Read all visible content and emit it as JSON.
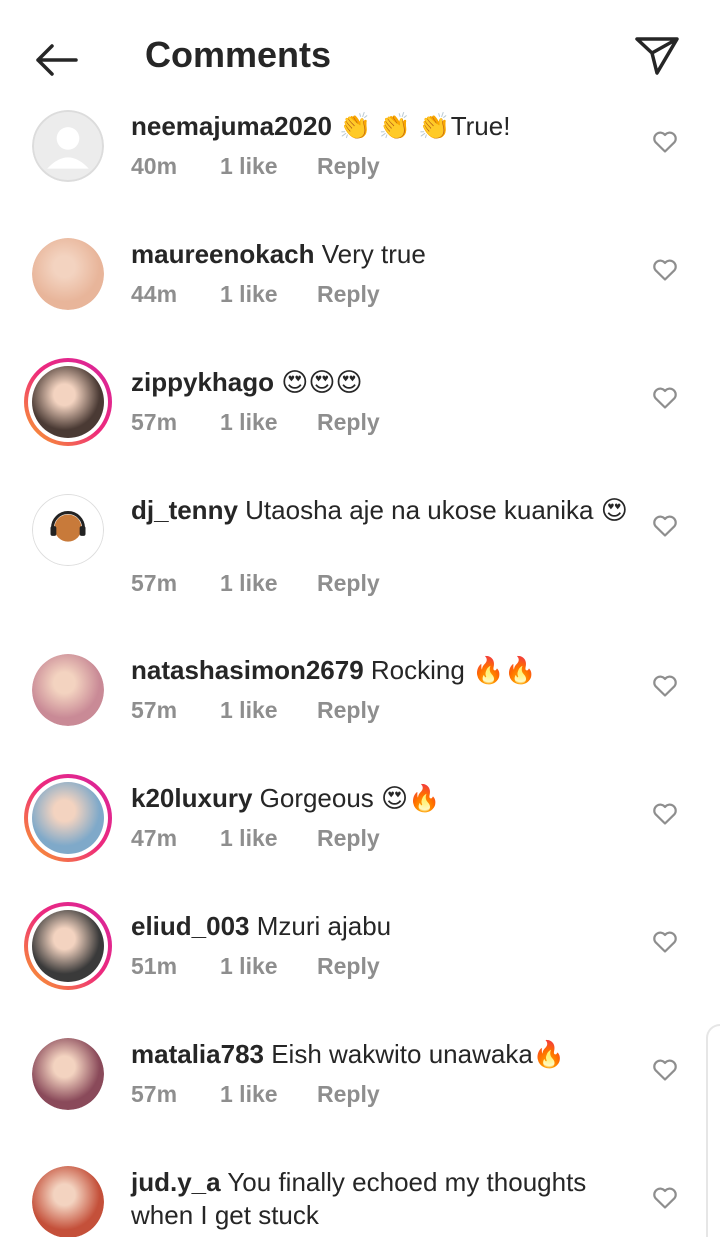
{
  "header": {
    "title": "Comments"
  },
  "comments": [
    {
      "username": "neemajuma2020",
      "text": " 👏 👏 👏True!",
      "time": "40m",
      "likes": "1 like",
      "reply": "Reply",
      "avatar_color": "#d8d8d8",
      "ring": false
    },
    {
      "username": "maureenokach",
      "text": " Very true",
      "time": "44m",
      "likes": "1 like",
      "reply": "Reply",
      "avatar_color": "#e8b59a",
      "ring": false
    },
    {
      "username": "zippykhago",
      "text": " 😍😍😍",
      "time": "57m",
      "likes": "1 like",
      "reply": "Reply",
      "avatar_color": "#4a3a34",
      "ring": true
    },
    {
      "username": "dj_tenny",
      "text": " Utaosha aje na ukose kuanika 😍",
      "time": "57m",
      "likes": "1 like",
      "reply": "Reply",
      "avatar_color": "#ffffff",
      "ring": false
    },
    {
      "username": "natashasimon2679",
      "text": " Rocking 🔥🔥",
      "time": "57m",
      "likes": "1 like",
      "reply": "Reply",
      "avatar_color": "#c98a96",
      "ring": false
    },
    {
      "username": "k20luxury",
      "text": " Gorgeous 😍🔥",
      "time": "47m",
      "likes": "1 like",
      "reply": "Reply",
      "avatar_color": "#7fa9c9",
      "ring": true
    },
    {
      "username": "eliud_003",
      "text": " Mzuri ajabu",
      "time": "51m",
      "likes": "1 like",
      "reply": "Reply",
      "avatar_color": "#3a3a3a",
      "ring": true
    },
    {
      "username": "matalia783",
      "text": " Eish wakwito unawaka🔥",
      "time": "57m",
      "likes": "1 like",
      "reply": "Reply",
      "avatar_color": "#8a4a5a",
      "ring": false
    },
    {
      "username": "jud.y_a",
      "text": " You finally echoed my thoughts when I get stuck",
      "time": "",
      "likes": "",
      "reply": "",
      "avatar_color": "#c4503a",
      "ring": false
    }
  ]
}
